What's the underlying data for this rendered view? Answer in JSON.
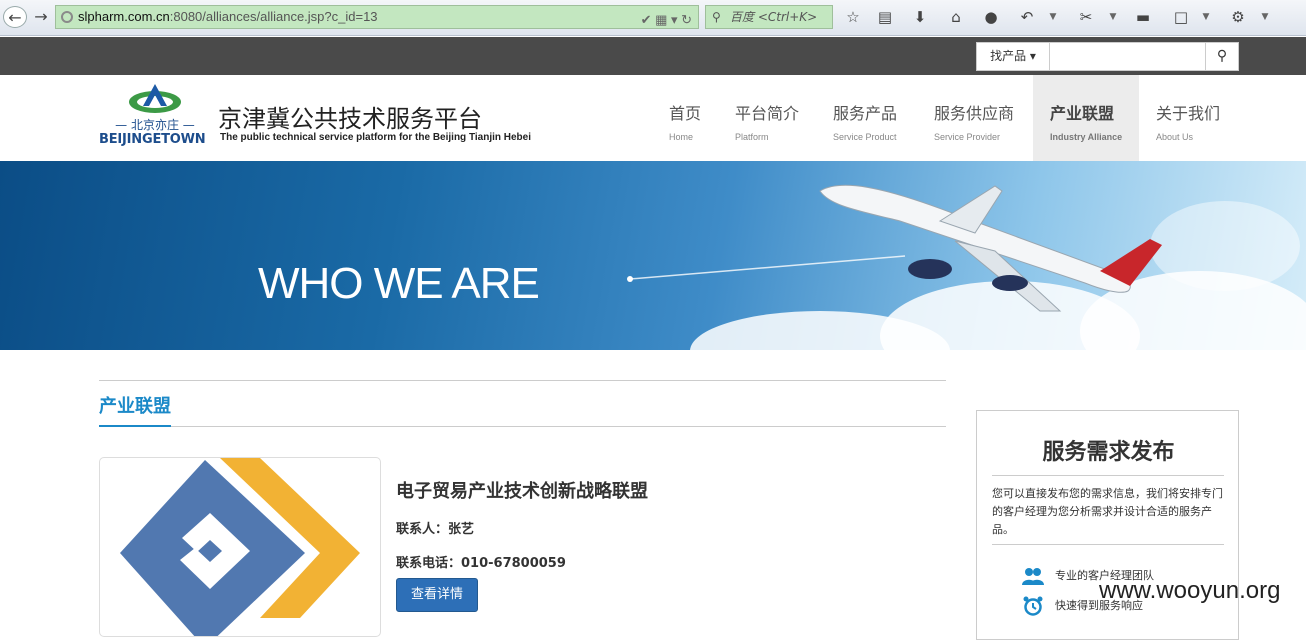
{
  "browser": {
    "url_host": "slpharm.com.cn",
    "url_path": ":8080/alliances/alliance.jsp?c_id=13",
    "search_placeholder": "百度 <Ctrl+K>"
  },
  "topbar": {
    "product_select": "找产品",
    "search_value": ""
  },
  "header": {
    "logo_text": "BEIJINGETOWN",
    "logo_cn": "— 北京亦庄 —",
    "site_title": "京津冀公共技术服务平台",
    "site_subtitle": "The public technical service platform for the Beijing Tianjin Hebei"
  },
  "nav": [
    {
      "cn": "首页",
      "en": "Home"
    },
    {
      "cn": "平台简介",
      "en": "Platform"
    },
    {
      "cn": "服务产品",
      "en": "Service Product"
    },
    {
      "cn": "服务供应商",
      "en": "Service Provider"
    },
    {
      "cn": "产业联盟",
      "en": "Industry Alliance",
      "active": true
    },
    {
      "cn": "关于我们",
      "en": "About Us"
    }
  ],
  "banner": {
    "text": "WHO WE ARE"
  },
  "section": {
    "title": "产业联盟"
  },
  "alliance": {
    "name": "电子贸易产业技术创新战略联盟",
    "contact": "联系人：张艺",
    "phone": "联系电话：010-67800059",
    "detail_button": "查看详情"
  },
  "sidebar": {
    "title": "服务需求发布",
    "desc": "您可以直接发布您的需求信息，我们将安排专门的客户经理为您分析需求并设计合适的服务产品。",
    "features": [
      "专业的客户经理团队",
      "快速得到服务响应"
    ]
  },
  "watermark": "www.wooyun.org",
  "colors": {
    "accent": "#1b89c8",
    "button": "#2d6fb7",
    "topbar": "#4a4a4a"
  }
}
